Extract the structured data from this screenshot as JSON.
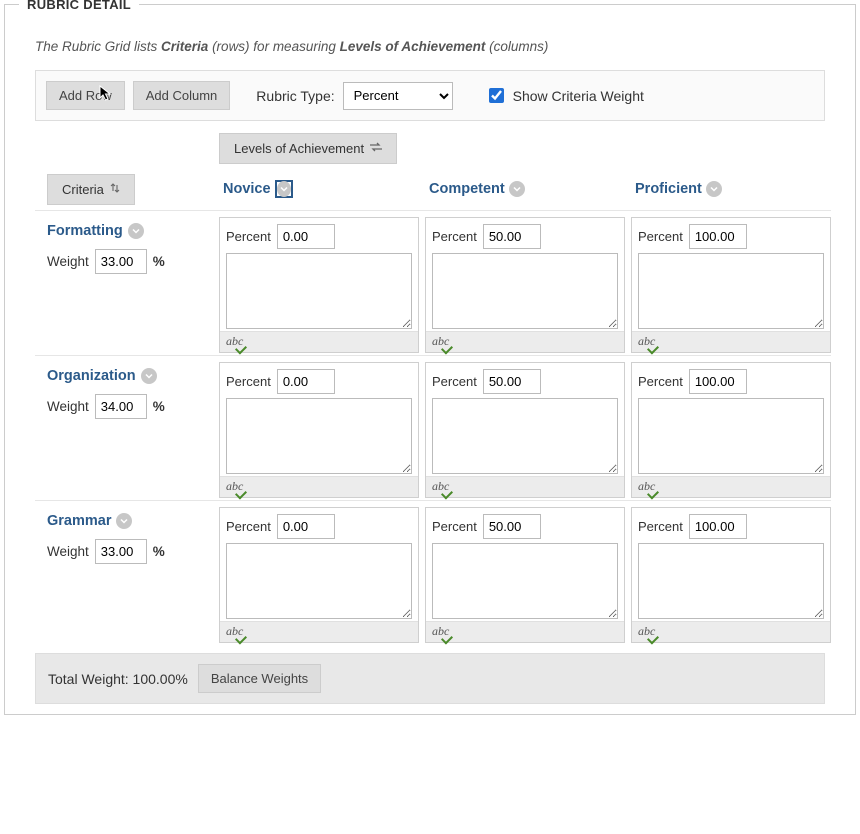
{
  "panel": {
    "title": "RUBRIC DETAIL"
  },
  "description": {
    "prefix": "The Rubric Grid lists ",
    "criteria": "Criteria",
    "mid": " (rows) for measuring ",
    "levels": "Levels of Achievement",
    "suffix": " (columns)"
  },
  "toolbar": {
    "add_row": "Add Row",
    "add_column": "Add Column",
    "rubric_type_label": "Rubric Type:",
    "rubric_type_value": "Percent",
    "show_weight_label": "Show Criteria Weight"
  },
  "headers": {
    "levels_pill": "Levels of Achievement",
    "criteria_pill": "Criteria"
  },
  "levels": [
    {
      "name": "Novice",
      "selected": true
    },
    {
      "name": "Competent",
      "selected": false
    },
    {
      "name": "Proficient",
      "selected": false
    }
  ],
  "criteria": [
    {
      "name": "Formatting",
      "weight": "33.00",
      "weight_label": "Weight",
      "unit": "%"
    },
    {
      "name": "Organization",
      "weight": "34.00",
      "weight_label": "Weight",
      "unit": "%"
    },
    {
      "name": "Grammar",
      "weight": "33.00",
      "weight_label": "Weight",
      "unit": "%"
    }
  ],
  "cells": {
    "label": "Percent",
    "spell_label": "abc",
    "rows": [
      [
        "0.00",
        "50.00",
        "100.00"
      ],
      [
        "0.00",
        "50.00",
        "100.00"
      ],
      [
        "0.00",
        "50.00",
        "100.00"
      ]
    ]
  },
  "footer": {
    "total_label": "Total Weight: 100.00%",
    "balance_btn": "Balance Weights"
  }
}
